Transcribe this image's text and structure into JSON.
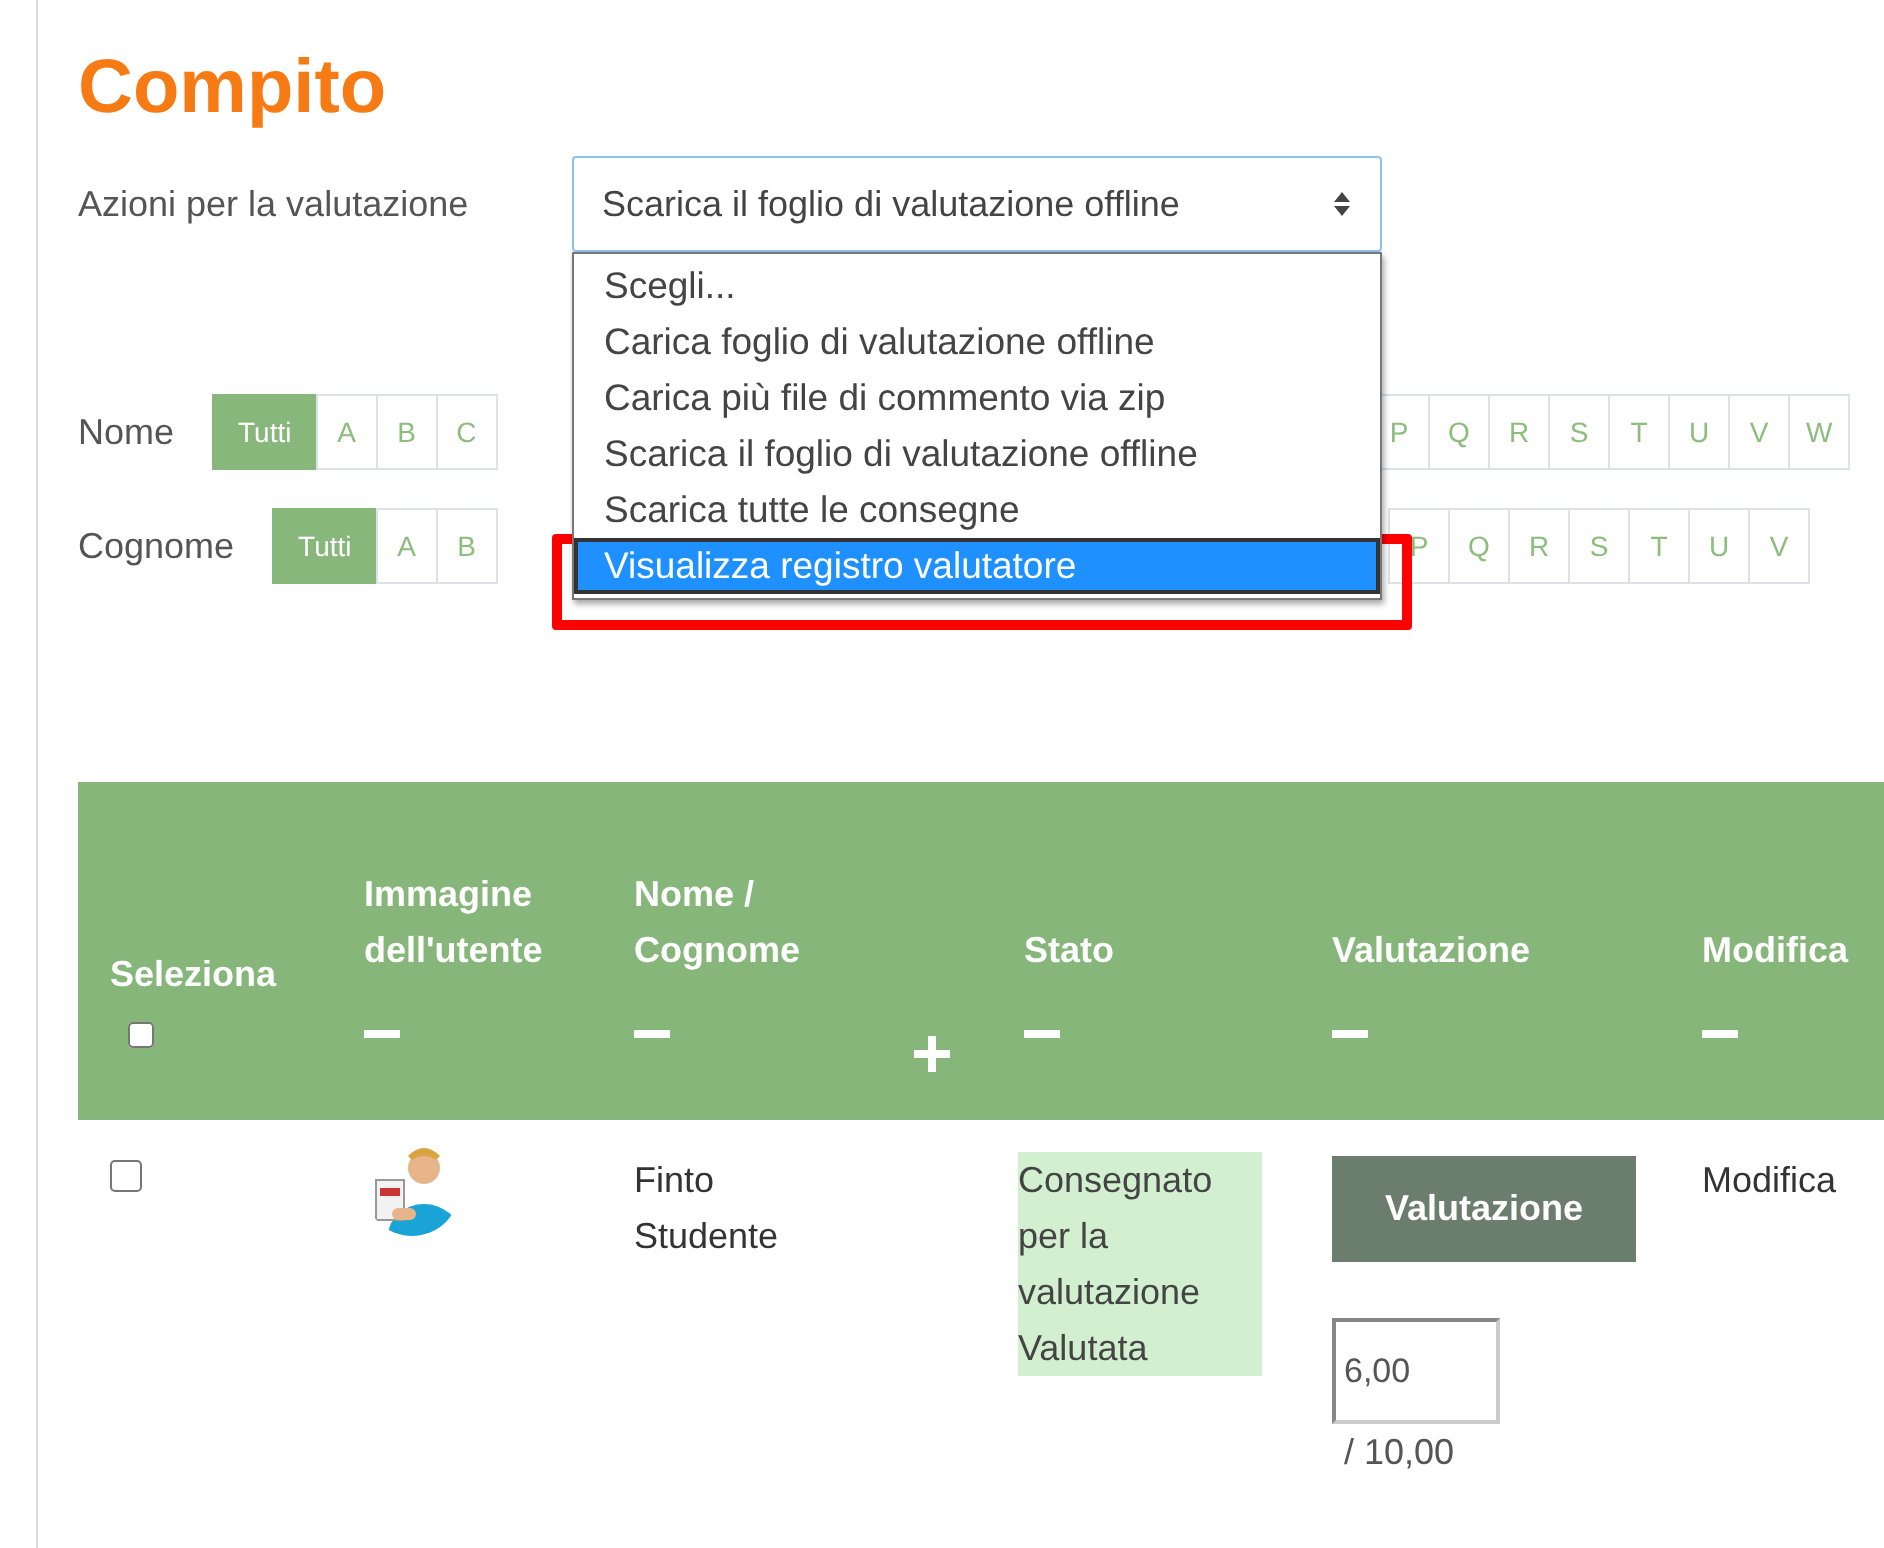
{
  "title": "Compito",
  "grading_actions": {
    "label": "Azioni per la valutazione",
    "value": "Scarica il foglio di valutazione offline",
    "expanded": true,
    "options": [
      {
        "label": "Scegli...",
        "highlighted": false,
        "annotated": false
      },
      {
        "label": "Carica foglio di valutazione offline",
        "highlighted": false,
        "annotated": false
      },
      {
        "label": "Carica più file di commento via zip",
        "highlighted": false,
        "annotated": false
      },
      {
        "label": "Scarica il foglio di valutazione offline",
        "highlighted": false,
        "annotated": false
      },
      {
        "label": "Scarica tutte le consegne",
        "highlighted": false,
        "annotated": false
      },
      {
        "label": "Visualizza registro valutatore",
        "highlighted": true,
        "annotated": true
      }
    ]
  },
  "filters": [
    {
      "label": "Nome",
      "letters_before": [
        {
          "label": "Tutti",
          "selected": true
        },
        {
          "label": "A",
          "selected": false
        },
        {
          "label": "B",
          "selected": false
        },
        {
          "label": "C",
          "selected": false
        }
      ],
      "letters_after": [
        {
          "label": "P",
          "selected": false
        },
        {
          "label": "Q",
          "selected": false
        },
        {
          "label": "R",
          "selected": false
        },
        {
          "label": "S",
          "selected": false
        },
        {
          "label": "T",
          "selected": false
        },
        {
          "label": "U",
          "selected": false
        },
        {
          "label": "V",
          "selected": false
        },
        {
          "label": "W",
          "selected": false
        }
      ]
    },
    {
      "label": "Cognome",
      "letters_before": [
        {
          "label": "Tutti",
          "selected": true
        },
        {
          "label": "A",
          "selected": false
        },
        {
          "label": "B",
          "selected": false
        }
      ],
      "letters_after": [
        {
          "label": "P",
          "selected": false
        },
        {
          "label": "Q",
          "selected": false
        },
        {
          "label": "R",
          "selected": false
        },
        {
          "label": "S",
          "selected": false
        },
        {
          "label": "T",
          "selected": false
        },
        {
          "label": "U",
          "selected": false
        },
        {
          "label": "V",
          "selected": false
        }
      ]
    }
  ],
  "table": {
    "columns": [
      {
        "label": "Seleziona",
        "kind": "checkbox",
        "checked": false
      },
      {
        "label": "Immagine dell'utente",
        "kind": "text"
      },
      {
        "label": "Nome / Cognome",
        "kind": "text"
      },
      {
        "kind": "plus"
      },
      {
        "label": "Stato",
        "kind": "text"
      },
      {
        "label": "Valutazione",
        "kind": "text"
      },
      {
        "label": "Modifica",
        "kind": "text"
      }
    ],
    "rows": [
      {
        "checked": false,
        "name": "Finto Studente",
        "status": "Consegnato per la valutazione Valutata",
        "grade_button": "Valutazione",
        "grade": "6,00",
        "max_grade": "/ 10,00",
        "edit": "Modifica"
      }
    ]
  }
}
